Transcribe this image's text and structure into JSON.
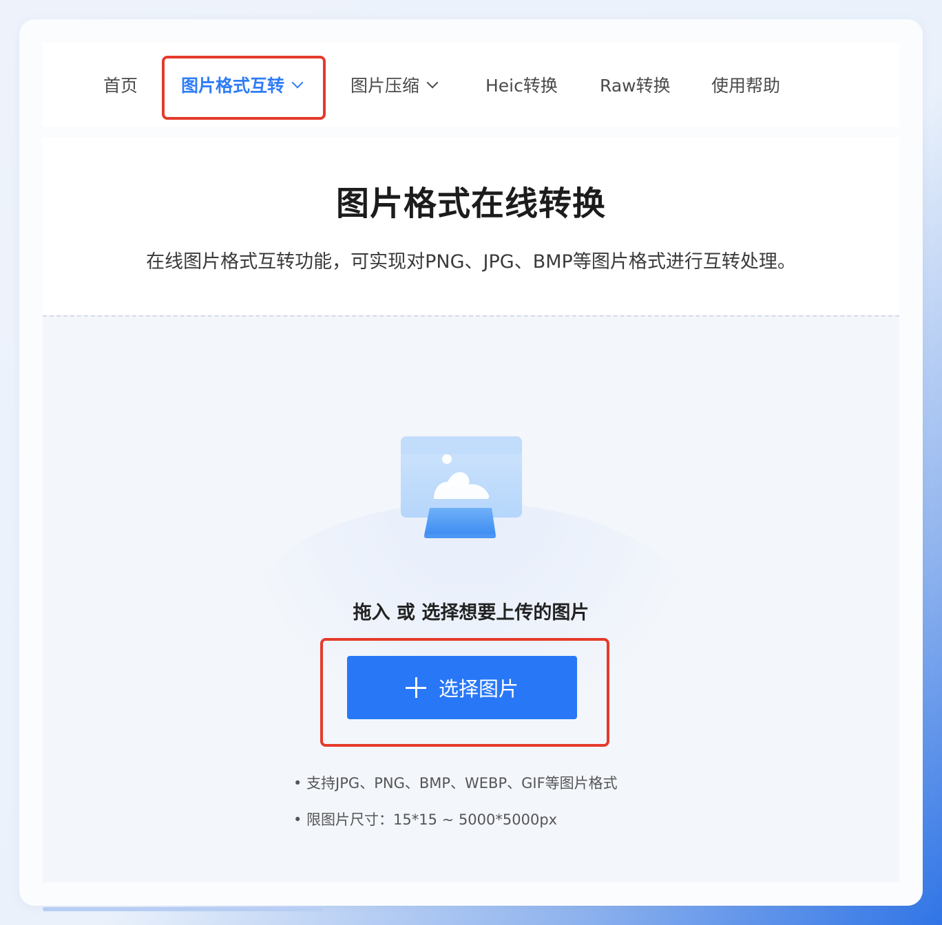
{
  "nav": {
    "items": [
      {
        "label": "首页",
        "active": false,
        "has_dropdown": false
      },
      {
        "label": "图片格式互转",
        "active": true,
        "has_dropdown": true
      },
      {
        "label": "图片压缩",
        "active": false,
        "has_dropdown": true
      },
      {
        "label": "Heic转换",
        "active": false,
        "has_dropdown": false
      },
      {
        "label": "Raw转换",
        "active": false,
        "has_dropdown": false
      },
      {
        "label": "使用帮助",
        "active": false,
        "has_dropdown": false
      }
    ]
  },
  "hero": {
    "title": "图片格式在线转换",
    "subtitle": "在线图片格式互转功能，可实现对PNG、JPG、BMP等图片格式进行互转处理。"
  },
  "upload": {
    "prompt": "拖入 或 选择想要上传的图片",
    "button_label": "选择图片",
    "button_icon": "plus-icon",
    "illustration_icon": "image-upload-icon",
    "notes": [
      "• 支持JPG、PNG、BMP、WEBP、GIF等图片格式",
      "• 限图片尺寸：15*15 ~ 5000*5000px"
    ]
  },
  "colors": {
    "accent": "#2877f7",
    "highlight": "#e53a2b",
    "active_nav": "#2f7cf6"
  }
}
